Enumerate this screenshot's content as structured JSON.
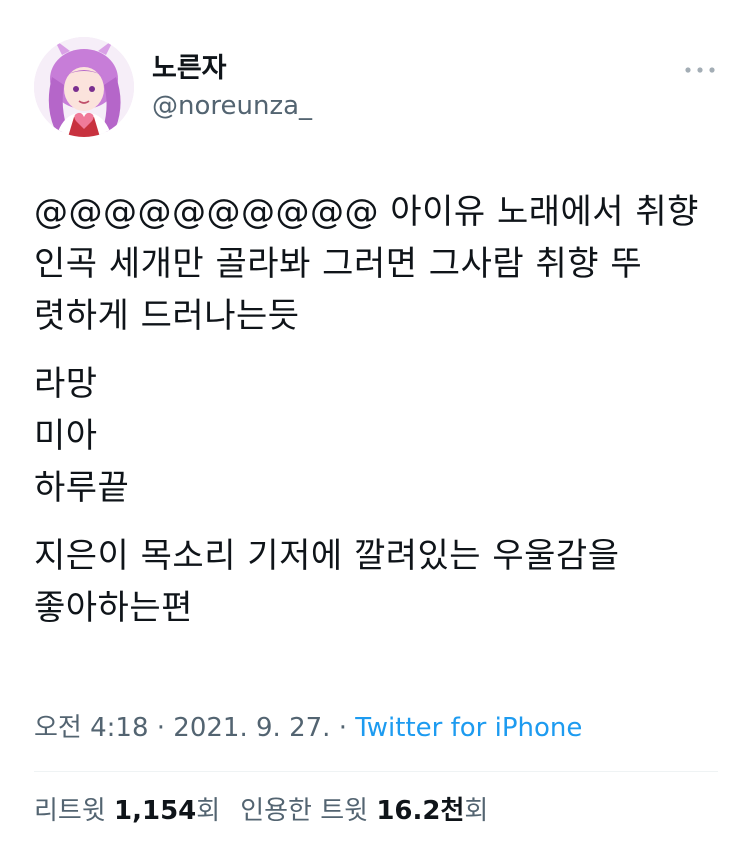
{
  "author": {
    "display_name": "노른자",
    "handle": "@noreunza_",
    "avatar_icon": "profile-avatar"
  },
  "more_icon": "more-horizontal-icon",
  "tweet": {
    "paragraphs": [
      {
        "lines": [
          "@@@@@@@@@@ 아이유 노래에서 취향",
          "인곡 세개만 골라봐 그러면 그사람 취향 뚜",
          "렷하게 드러나는듯"
        ]
      },
      {
        "lines": [
          "라망",
          "미아",
          "하루끝"
        ]
      },
      {
        "lines": [
          "지은이 목소리 기저에 깔려있는 우울감을",
          "좋아하는편"
        ]
      }
    ]
  },
  "meta": {
    "time": "오전 4:18",
    "separator": "·",
    "date": "2021. 9. 27.",
    "source": "Twitter for iPhone"
  },
  "stats": {
    "retweets_label": "리트윗",
    "retweets_count": "1,154",
    "retweets_suffix": "회",
    "quotes_label": "인용한 트윗",
    "quotes_count": "16.2천",
    "quotes_suffix": "회"
  },
  "colors": {
    "text": "#0f1419",
    "secondary": "#536471",
    "link": "#1d9bf0",
    "divider": "#eff3f4"
  }
}
